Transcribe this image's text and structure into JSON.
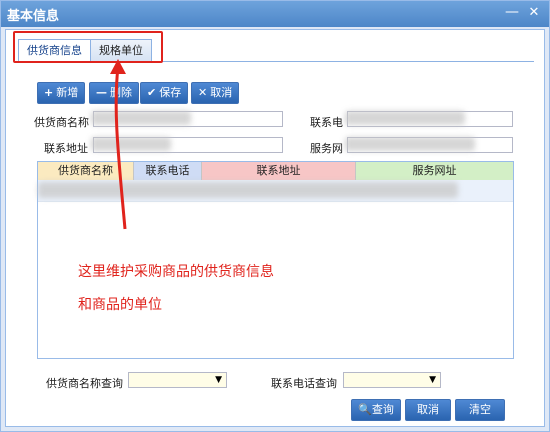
{
  "window": {
    "title": "基本信息",
    "minimize_glyph": "—",
    "close_glyph": "✕"
  },
  "tabs": [
    {
      "label": "供货商信息",
      "active": true
    },
    {
      "label": "规格单位",
      "active": false
    }
  ],
  "toolbar": {
    "add": {
      "icon": "plus-icon",
      "glyph": "+",
      "label": "新增"
    },
    "delete": {
      "icon": "minus-icon",
      "glyph": "—",
      "label": "删除"
    },
    "save": {
      "icon": "check-icon",
      "glyph": "✔",
      "label": "保存"
    },
    "cancel": {
      "icon": "x-icon",
      "glyph": "✕",
      "label": "取消"
    }
  },
  "form": {
    "supplier_name_label": "供货商名称",
    "contact_label": "联系电",
    "address_label": "联系地址",
    "website_label": "服务网"
  },
  "grid": {
    "columns": [
      "供货商名称",
      "联系电话",
      "联系地址",
      "服务网址"
    ]
  },
  "annotation": {
    "line1": "这里维护采购商品的供货商信息",
    "line2": "和商品的单位",
    "color": "#e0231c"
  },
  "filter": {
    "supplier_query_label": "供货商名称查询",
    "phone_query_label": "联系电话查询",
    "query_button": "查询",
    "cancel_button": "取消",
    "clear_button": "清空"
  }
}
